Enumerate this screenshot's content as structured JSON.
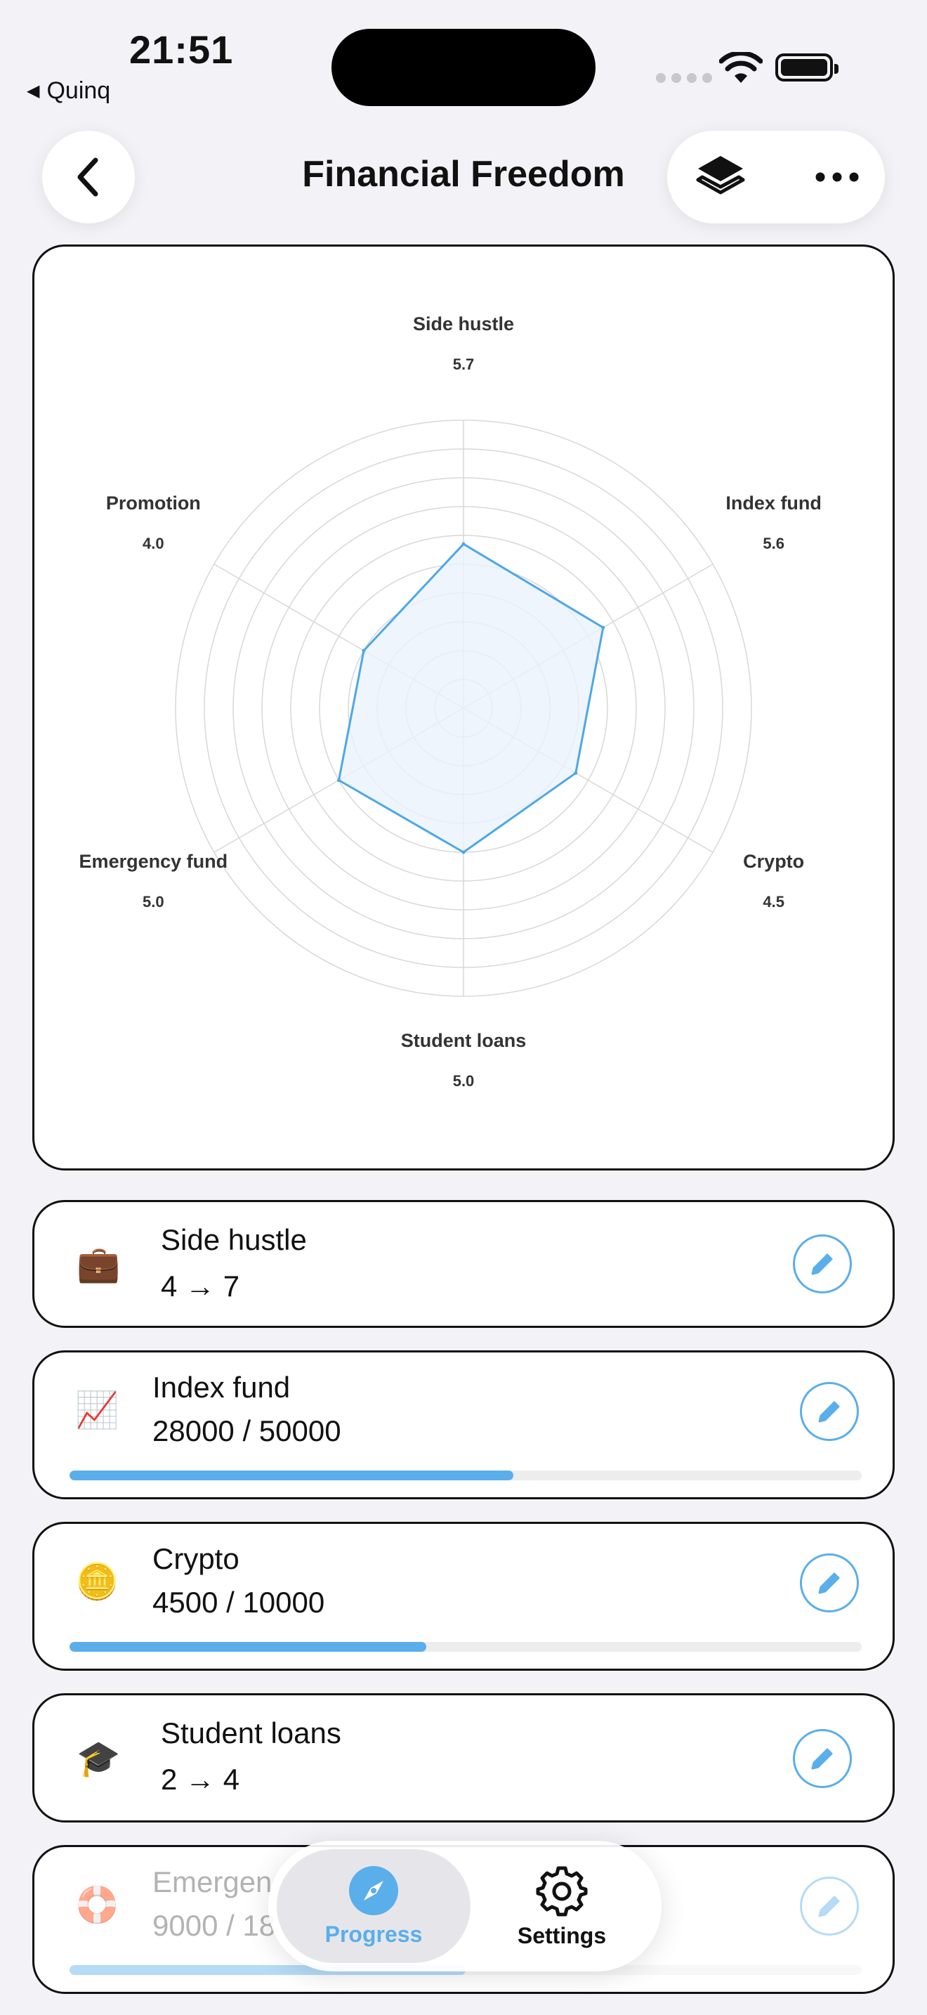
{
  "status_bar": {
    "time": "21:51",
    "back_app": "Quinq"
  },
  "header": {
    "title": "Financial Freedom",
    "back_icon": "chevron-left-icon",
    "layers_icon": "layers-icon",
    "more_icon": "ellipsis-icon"
  },
  "chart_data": {
    "type": "radar",
    "categories": [
      "Side hustle",
      "Index fund",
      "Crypto",
      "Student loans",
      "Emergency fund",
      "Promotion"
    ],
    "values": [
      5.7,
      5.6,
      4.5,
      5.0,
      5.0,
      4.0
    ],
    "value_labels": [
      "5.7",
      "5.6",
      "4.5",
      "5.0",
      "5.0",
      "4.0"
    ],
    "rmax": 10,
    "grid_rings": 10,
    "colors": {
      "line": "#4da8e6",
      "fill": "#eaf3fb",
      "grid": "#d8d8d8"
    }
  },
  "goals": [
    {
      "emoji": "💼",
      "name": "Side hustle",
      "progress": "4 → 7"
    },
    {
      "emoji": "📈",
      "name": "Index fund",
      "progress": "28000 / 50000",
      "fraction": 0.56
    },
    {
      "emoji": "🪙",
      "name": "Crypto",
      "progress": "4500 / 10000",
      "fraction": 0.45
    },
    {
      "emoji": "🎓",
      "name": "Student loans",
      "progress": "2 → 4"
    },
    {
      "emoji": "🛟",
      "name": "Emergen",
      "progress": "9000 / 18",
      "fraction": 0.5
    }
  ],
  "tabbar": {
    "progress_label": "Progress",
    "settings_label": "Settings",
    "progress_icon": "compass-icon",
    "settings_icon": "gear-icon"
  },
  "colors": {
    "accent": "#5aaeea",
    "background": "#f2f2f7"
  }
}
